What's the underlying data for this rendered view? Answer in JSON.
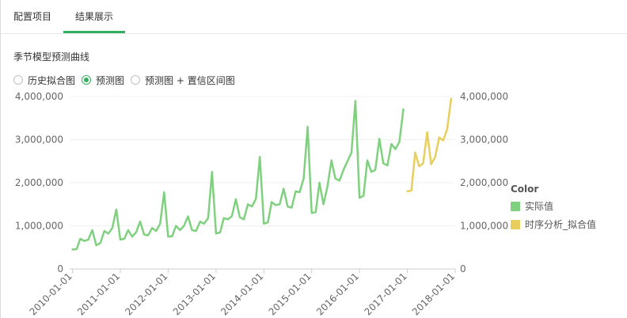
{
  "tabs": [
    {
      "label": "配置项目",
      "active": false
    },
    {
      "label": "结果展示",
      "active": true
    }
  ],
  "section_title": "季节模型预测曲线",
  "radio_options": [
    {
      "label": "历史拟合图",
      "checked": false
    },
    {
      "label": "预测图",
      "checked": true
    },
    {
      "label": "预测图 + 置信区间图",
      "checked": false
    }
  ],
  "legend": {
    "title": "Color",
    "items": [
      {
        "label": "实际值",
        "color": "#7fd17f"
      },
      {
        "label": "时序分析_拟合值",
        "color": "#e8cf5d"
      }
    ]
  },
  "accent_color": "#33b05f",
  "chart_data": {
    "type": "line",
    "xlabel": "",
    "ylabel": "",
    "ylim": [
      0,
      4000000
    ],
    "y_ticks": [
      "0",
      "1,000,000",
      "2,000,000",
      "3,000,000",
      "4,000,000"
    ],
    "y2_ticks": [
      "0",
      "1,000,000",
      "2,000,000",
      "3,000,000",
      "4,000,000"
    ],
    "x_ticks": [
      "2010-01-01",
      "2011-01-01",
      "2012-01-01",
      "2013-01-01",
      "2014-01-01",
      "2015-01-01",
      "2016-01-01",
      "2017-01-01",
      "2018-01-01"
    ],
    "grid": true,
    "legend_position": "right",
    "series": [
      {
        "name": "实际值",
        "color": "#7fd17f",
        "x": [
          "2010-01-01",
          "2010-02-01",
          "2010-03-01",
          "2010-04-01",
          "2010-05-01",
          "2010-06-01",
          "2010-07-01",
          "2010-08-01",
          "2010-09-01",
          "2010-10-01",
          "2010-11-01",
          "2010-12-01",
          "2011-01-01",
          "2011-02-01",
          "2011-03-01",
          "2011-04-01",
          "2011-05-01",
          "2011-06-01",
          "2011-07-01",
          "2011-08-01",
          "2011-09-01",
          "2011-10-01",
          "2011-11-01",
          "2011-12-01",
          "2012-01-01",
          "2012-02-01",
          "2012-03-01",
          "2012-04-01",
          "2012-05-01",
          "2012-06-01",
          "2012-07-01",
          "2012-08-01",
          "2012-09-01",
          "2012-10-01",
          "2012-11-01",
          "2012-12-01",
          "2013-01-01",
          "2013-02-01",
          "2013-03-01",
          "2013-04-01",
          "2013-05-01",
          "2013-06-01",
          "2013-07-01",
          "2013-08-01",
          "2013-09-01",
          "2013-10-01",
          "2013-11-01",
          "2013-12-01",
          "2014-01-01",
          "2014-02-01",
          "2014-03-01",
          "2014-04-01",
          "2014-05-01",
          "2014-06-01",
          "2014-07-01",
          "2014-08-01",
          "2014-09-01",
          "2014-10-01",
          "2014-11-01",
          "2014-12-01",
          "2015-01-01",
          "2015-02-01",
          "2015-03-01",
          "2015-04-01",
          "2015-05-01",
          "2015-06-01",
          "2015-07-01",
          "2015-08-01",
          "2015-09-01",
          "2015-10-01",
          "2015-11-01",
          "2015-12-01",
          "2016-01-01",
          "2016-02-01",
          "2016-03-01",
          "2016-04-01",
          "2016-05-01",
          "2016-06-01",
          "2016-07-01",
          "2016-08-01",
          "2016-09-01",
          "2016-10-01",
          "2016-11-01",
          "2016-12-01"
        ],
        "values": [
          450000,
          460000,
          700000,
          650000,
          680000,
          900000,
          550000,
          600000,
          880000,
          820000,
          950000,
          1380000,
          680000,
          700000,
          900000,
          750000,
          850000,
          1100000,
          800000,
          780000,
          950000,
          880000,
          1050000,
          1780000,
          750000,
          760000,
          1000000,
          900000,
          1000000,
          1220000,
          900000,
          880000,
          1100000,
          1050000,
          1180000,
          2250000,
          820000,
          850000,
          1180000,
          1150000,
          1220000,
          1620000,
          1200000,
          1150000,
          1500000,
          1450000,
          1620000,
          2600000,
          1050000,
          1080000,
          1550000,
          1480000,
          1500000,
          1860000,
          1450000,
          1420000,
          1800000,
          1780000,
          2100000,
          3300000,
          1300000,
          1320000,
          2000000,
          1500000,
          1900000,
          2520000,
          2100000,
          2050000,
          2300000,
          2500000,
          2700000,
          3900000,
          1650000,
          1700000,
          2520000,
          2250000,
          2300000,
          3020000,
          2450000,
          2400000,
          2900000,
          2780000,
          2950000,
          3700000
        ]
      },
      {
        "name": "时序分析_拟合值",
        "color": "#e8cf5d",
        "x": [
          "2017-01-01",
          "2017-02-01",
          "2017-03-01",
          "2017-04-01",
          "2017-05-01",
          "2017-06-01",
          "2017-07-01",
          "2017-08-01",
          "2017-09-01",
          "2017-10-01",
          "2017-11-01",
          "2017-12-01"
        ],
        "values": [
          1800000,
          1820000,
          2700000,
          2380000,
          2450000,
          3170000,
          2430000,
          2600000,
          3050000,
          2980000,
          3250000,
          3950000
        ]
      }
    ]
  }
}
